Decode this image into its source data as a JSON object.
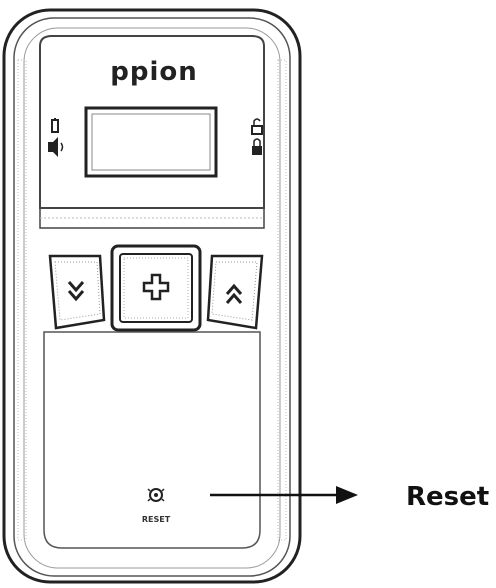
{
  "device": {
    "brand_logo": "ppion",
    "reset_button_label": "RESET",
    "buttons": {
      "left_icon": "double-chevron-down-icon",
      "center_icon": "plus-icon",
      "right_icon": "double-chevron-up-icon"
    },
    "left_indicators": [
      "battery-icon",
      "speaker-icon"
    ],
    "right_indicators": [
      "lock-open-icon",
      "lock-closed-icon"
    ]
  },
  "callout": {
    "label": "Reset"
  }
}
